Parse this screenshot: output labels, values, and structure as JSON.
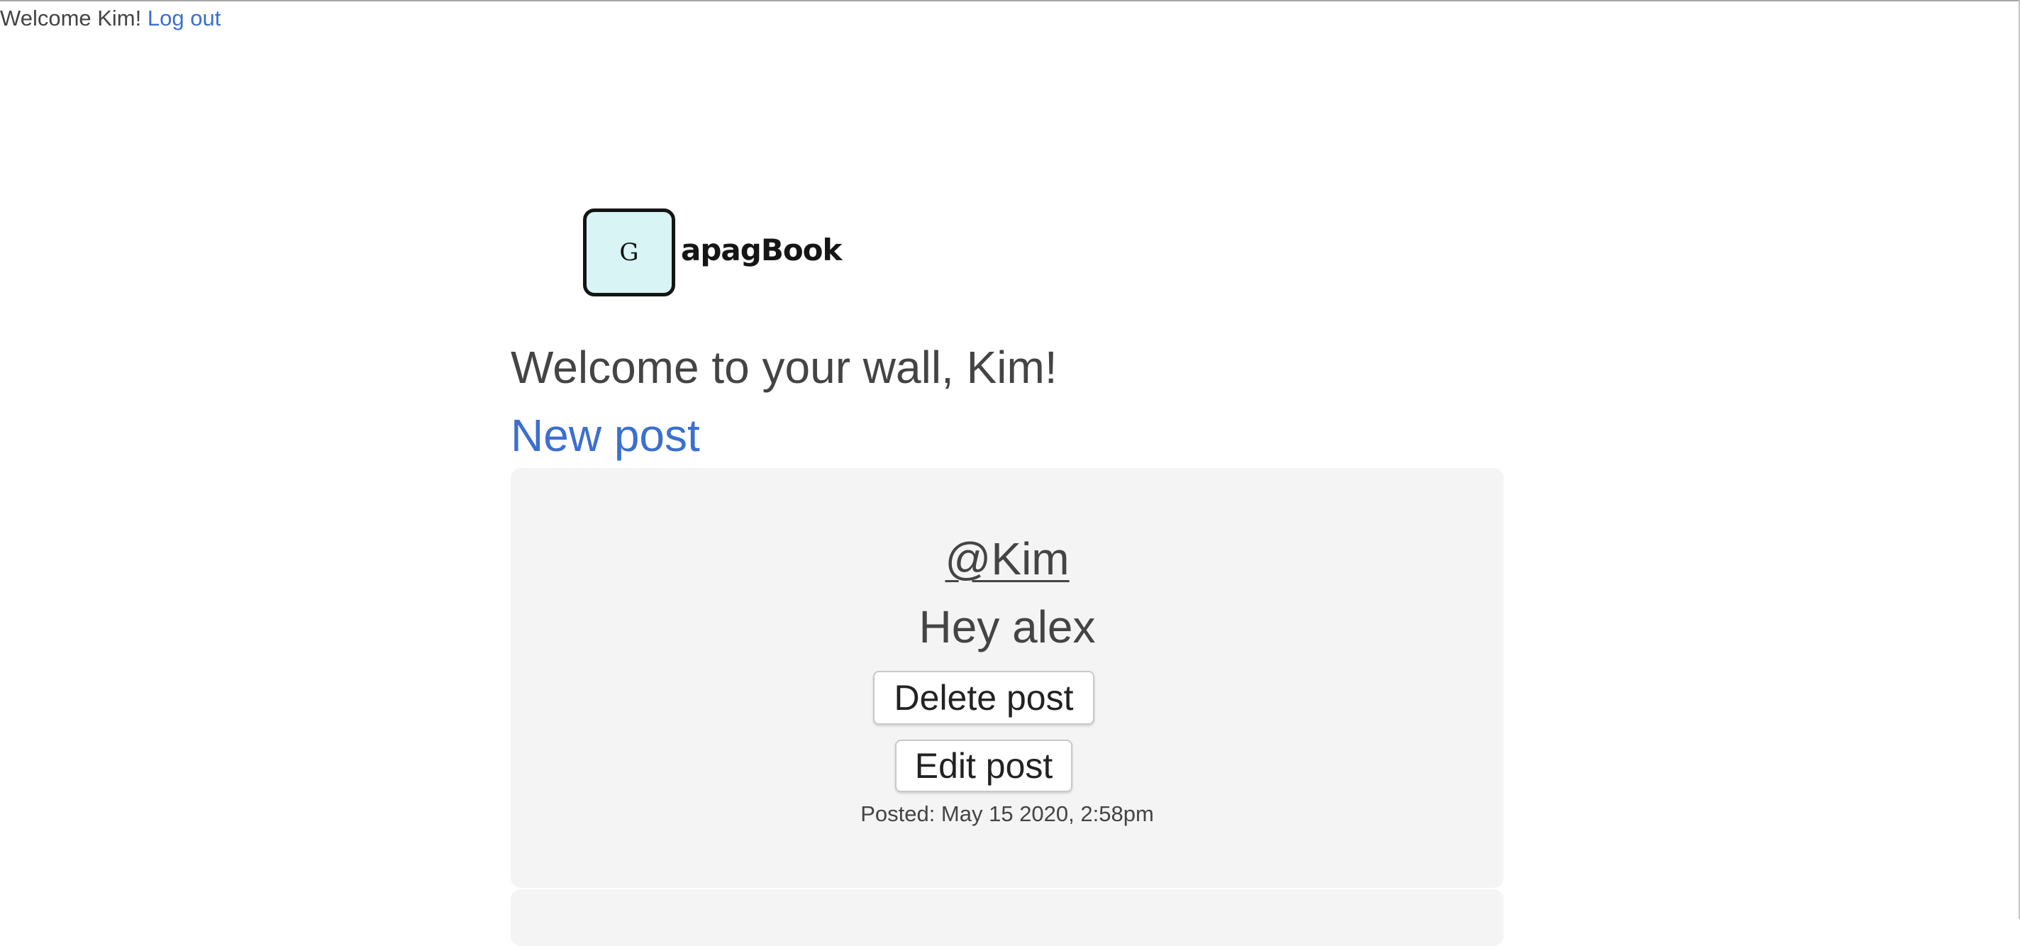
{
  "header": {
    "welcome_text": "Welcome Kim!",
    "logout_label": "Log out"
  },
  "logo": {
    "icon_letter": "G",
    "name": "apagBook"
  },
  "wall": {
    "title": "Welcome to your wall, Kim!",
    "new_post_label": "New post"
  },
  "posts": [
    {
      "author": "@Kim",
      "body": "Hey alex",
      "delete_label": "Delete post",
      "edit_label": "Edit post",
      "posted": "Posted: May 15 2020, 2:58pm"
    }
  ],
  "colors": {
    "link": "#3b6fd0",
    "text": "#444444",
    "card_background": "#f4f4f4",
    "logo_background": "#d8f4f5"
  }
}
